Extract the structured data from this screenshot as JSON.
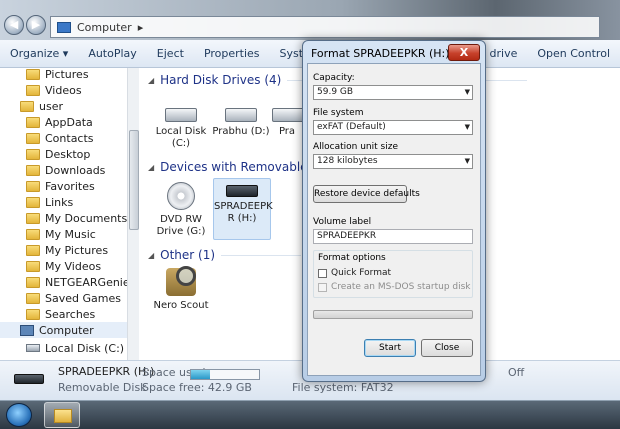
{
  "explorer": {
    "address": {
      "location": "Computer"
    },
    "toolbar": [
      "Organize ▾",
      "AutoPlay",
      "Eject",
      "Properties",
      "System propert",
      "network drive",
      "Open Control"
    ],
    "sidebar": [
      {
        "label": "Pictures",
        "icon": "folder-icon"
      },
      {
        "label": "Videos",
        "icon": "folder-icon"
      },
      {
        "label": "user",
        "icon": "user-icon"
      },
      {
        "label": "AppData",
        "icon": "folder-icon"
      },
      {
        "label": "Contacts",
        "icon": "folder-icon"
      },
      {
        "label": "Desktop",
        "icon": "folder-icon"
      },
      {
        "label": "Downloads",
        "icon": "folder-icon"
      },
      {
        "label": "Favorites",
        "icon": "folder-icon"
      },
      {
        "label": "Links",
        "icon": "folder-icon"
      },
      {
        "label": "My Documents",
        "icon": "folder-icon"
      },
      {
        "label": "My Music",
        "icon": "folder-icon"
      },
      {
        "label": "My Pictures",
        "icon": "folder-icon"
      },
      {
        "label": "My Videos",
        "icon": "folder-icon"
      },
      {
        "label": "NETGEARGenie",
        "icon": "folder-icon"
      },
      {
        "label": "Saved Games",
        "icon": "folder-icon"
      },
      {
        "label": "Searches",
        "icon": "folder-icon"
      },
      {
        "label": "Computer",
        "icon": "computer-icon"
      },
      {
        "label": "Local Disk (C:)",
        "icon": "disk-icon"
      }
    ],
    "groups": {
      "hard_disk": "Hard Disk Drives (4)",
      "removable": "Devices with Removable Storag",
      "other": "Other (1)"
    },
    "drives": {
      "local_c": "Local Disk (C:)",
      "prabhu_d": "Prabhu (D:)",
      "pra": "Pra",
      "dvd": "DVD RW Drive (G:)",
      "spradeep": "SPRADEEPK R (H:)",
      "nero": "Nero Scout"
    },
    "details": {
      "name": "SPRADEEPKR (H:)",
      "type": "Removable Disk",
      "space_used_label": "Space used:",
      "space_free": "Space free: 42.9 GB",
      "file_system": "File system: FAT32",
      "status": "Off",
      "used_fraction": 0.28
    }
  },
  "dialog": {
    "title": "Format SPRADEEPKR (H:)",
    "close_label": "X",
    "capacity_label": "Capacity:",
    "capacity_value": "59.9 GB",
    "filesystem_label": "File system",
    "filesystem_value": "exFAT (Default)",
    "alloc_label": "Allocation unit size",
    "alloc_value": "128 kilobytes",
    "restore_label": "Restore device defaults",
    "volume_label": "Volume label",
    "volume_value": "SPRADEEPKR",
    "format_options": "Format options",
    "quick_format": "Quick Format",
    "msdos": "Create an MS-DOS startup disk",
    "start": "Start",
    "close": "Close"
  },
  "colors": {
    "accent": "#1e3287",
    "close_red": "#c7412b"
  }
}
